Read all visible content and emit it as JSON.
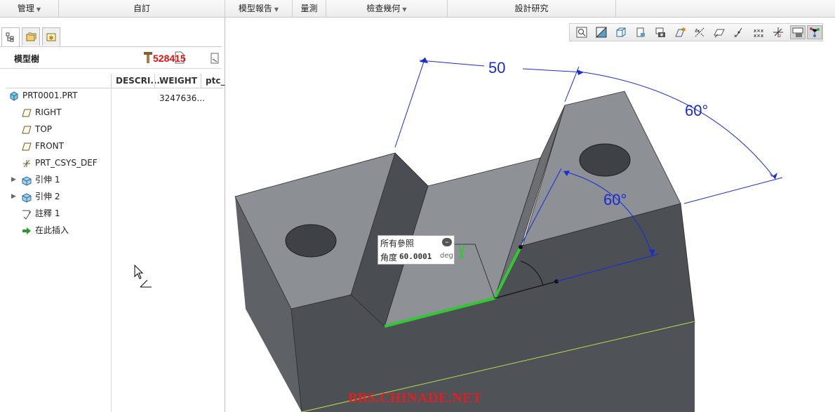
{
  "menubar": {
    "items": [
      {
        "label": "管理",
        "dropdown": true
      },
      {
        "label": "自訂",
        "dropdown": false
      },
      {
        "label": "模型報告",
        "dropdown": true
      },
      {
        "label": "量測",
        "dropdown": false
      },
      {
        "label": "檢查幾何",
        "dropdown": true
      },
      {
        "label": "設計研究",
        "dropdown": false
      }
    ]
  },
  "left_panel": {
    "tabs": [
      "model-tree-tab",
      "folder-browser-tab",
      "favorites-tab"
    ],
    "title": "模型樹",
    "overlay_text": "528415",
    "columns": [
      "DESCRI...",
      "WEIGHT",
      "ptc_"
    ],
    "tree_items": [
      {
        "label": "PRT0001.PRT",
        "icon": "part-icon",
        "weight": "3247636..."
      },
      {
        "label": "RIGHT",
        "icon": "datum-plane-icon"
      },
      {
        "label": "TOP",
        "icon": "datum-plane-icon"
      },
      {
        "label": "FRONT",
        "icon": "datum-plane-icon"
      },
      {
        "label": "PRT_CSYS_DEF",
        "icon": "csys-icon"
      },
      {
        "label": "引伸 1",
        "icon": "extrude-icon",
        "expandable": true
      },
      {
        "label": "引伸 2",
        "icon": "extrude-icon",
        "expandable": true
      },
      {
        "label": "註釋 1",
        "icon": "annotation-icon"
      },
      {
        "label": "在此插入",
        "icon": "insert-here-icon"
      }
    ]
  },
  "view_toolbar": {
    "buttons": [
      "zoom-icon",
      "shading-icon",
      "box-view-icon",
      "saved-views-icon",
      "camera-icon",
      "datum-display-icon",
      "axis-display-icon",
      "plane-display-icon",
      "point-display-icon",
      "csys-display-icon",
      "spin-center-icon",
      "annotation-display-icon",
      "model-tree-filter-icon"
    ]
  },
  "model": {
    "dimensions": [
      "50",
      "60°",
      "60°"
    ]
  },
  "popup": {
    "title": "所有參照",
    "field_label": "角度",
    "field_value": "60.0001",
    "unit": "deg"
  },
  "watermark": "BBS.CHINADE.NET"
}
